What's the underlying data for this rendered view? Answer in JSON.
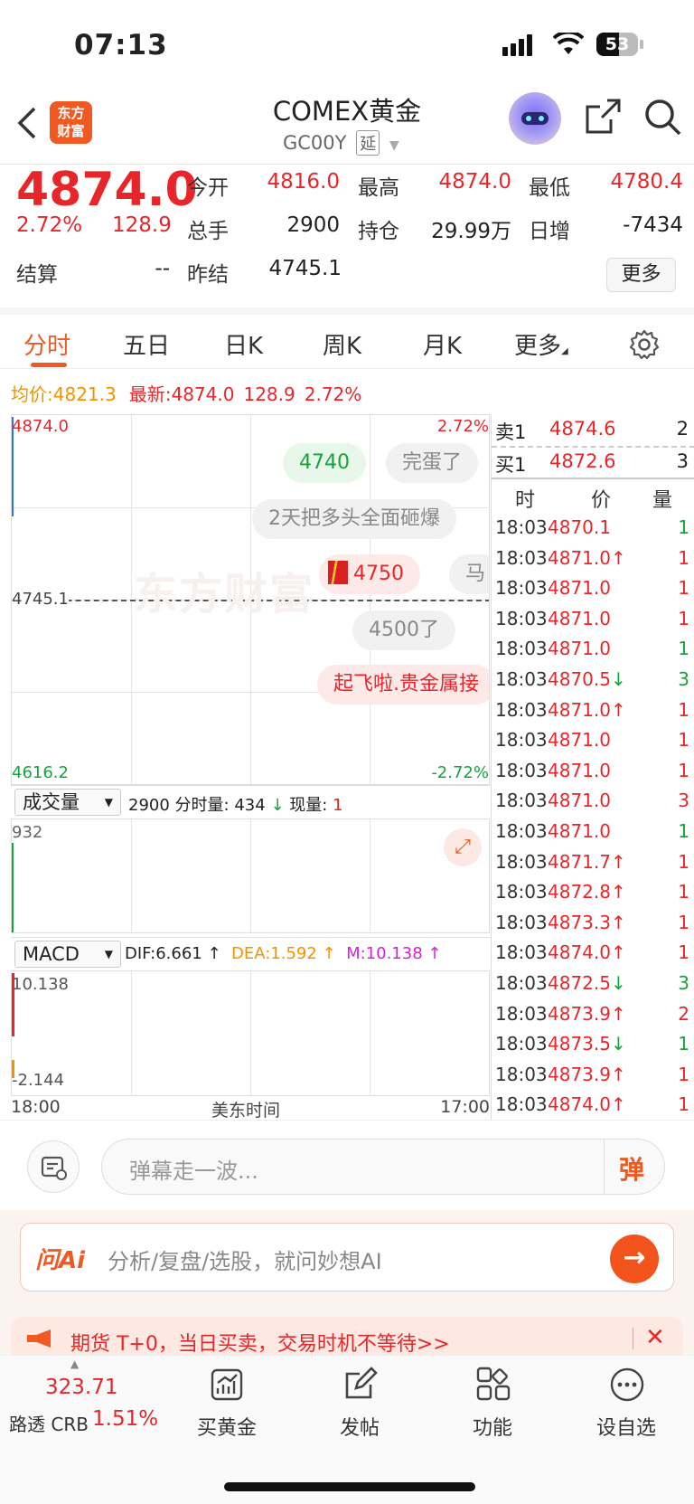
{
  "status_bar": {
    "time": "07:13",
    "battery": "53"
  },
  "header": {
    "logo_text_1": "东方",
    "logo_text_2": "财富",
    "title": "COMEX黄金",
    "code": "GC00Y",
    "delay_badge": "延"
  },
  "quote": {
    "price": "4874.0",
    "change_pct": "2.72%",
    "change": "128.9",
    "open_label": "今开",
    "open": "4816.0",
    "high_label": "最高",
    "high": "4874.0",
    "low_label": "最低",
    "low": "4780.4",
    "volume_label": "总手",
    "volume": "2900",
    "position_label": "持仓",
    "position": "29.99万",
    "daily_inc_label": "日增",
    "daily_inc": "-7434",
    "settle_label": "结算",
    "settle": "--",
    "prev_settle_label": "昨结",
    "prev_settle": "4745.1",
    "more_btn": "更多"
  },
  "tabs": [
    "分时",
    "五日",
    "日K",
    "周K",
    "月K",
    "更多"
  ],
  "avg_line": {
    "avg_label": "均价:",
    "avg": "4821.3",
    "last_label": "最新:",
    "last": "4874.0",
    "chg": "128.9",
    "pct": "2.72%"
  },
  "price_chart": {
    "top": "4874.0",
    "top_pct": "2.72%",
    "mid": "4745.1",
    "bottom": "4616.2",
    "bottom_pct": "-2.72%",
    "watermark": "东方财富"
  },
  "danmaku": [
    "4740",
    "完蛋了",
    "2天把多头全面砸爆",
    "4750",
    "马",
    "4500了",
    "起飞啦.贵金属接"
  ],
  "volume_chart": {
    "selector": "成交量",
    "vol": "2900",
    "fen_label": "分时量:",
    "fen": "434",
    "cur_label": "现量:",
    "cur": "1",
    "max": "932"
  },
  "macd_chart": {
    "selector": "MACD",
    "dif": "DIF:6.661",
    "dea": "DEA:1.592",
    "m": "M:10.138",
    "max": "10.138",
    "min": "-2.144"
  },
  "time_axis": {
    "start": "18:00",
    "mid": "美东时间",
    "end": "17:00"
  },
  "orderbook": {
    "sell_label": "卖1",
    "sell_price": "4874.6",
    "sell_qty": "2",
    "buy_label": "买1",
    "buy_price": "4872.6",
    "buy_qty": "3"
  },
  "trade_headers": {
    "time": "时",
    "price": "价",
    "qty": "量"
  },
  "trades": [
    {
      "t": "18:03",
      "p": "4870.1",
      "a": "",
      "v": "1",
      "pc": "red",
      "vc": "green"
    },
    {
      "t": "18:03",
      "p": "4871.0",
      "a": "↑",
      "v": "1",
      "pc": "red",
      "vc": "red"
    },
    {
      "t": "18:03",
      "p": "4871.0",
      "a": "",
      "v": "1",
      "pc": "red",
      "vc": "red"
    },
    {
      "t": "18:03",
      "p": "4871.0",
      "a": "",
      "v": "1",
      "pc": "red",
      "vc": "red"
    },
    {
      "t": "18:03",
      "p": "4871.0",
      "a": "",
      "v": "1",
      "pc": "red",
      "vc": "green"
    },
    {
      "t": "18:03",
      "p": "4870.5",
      "a": "↓",
      "v": "3",
      "pc": "red",
      "vc": "green"
    },
    {
      "t": "18:03",
      "p": "4871.0",
      "a": "↑",
      "v": "1",
      "pc": "red",
      "vc": "red"
    },
    {
      "t": "18:03",
      "p": "4871.0",
      "a": "",
      "v": "1",
      "pc": "red",
      "vc": "red"
    },
    {
      "t": "18:03",
      "p": "4871.0",
      "a": "",
      "v": "1",
      "pc": "red",
      "vc": "red"
    },
    {
      "t": "18:03",
      "p": "4871.0",
      "a": "",
      "v": "3",
      "pc": "red",
      "vc": "red"
    },
    {
      "t": "18:03",
      "p": "4871.0",
      "a": "",
      "v": "1",
      "pc": "red",
      "vc": "green"
    },
    {
      "t": "18:03",
      "p": "4871.7",
      "a": "↑",
      "v": "1",
      "pc": "red",
      "vc": "red"
    },
    {
      "t": "18:03",
      "p": "4872.8",
      "a": "↑",
      "v": "1",
      "pc": "red",
      "vc": "red"
    },
    {
      "t": "18:03",
      "p": "4873.3",
      "a": "↑",
      "v": "1",
      "pc": "red",
      "vc": "red"
    },
    {
      "t": "18:03",
      "p": "4874.0",
      "a": "↑",
      "v": "1",
      "pc": "red",
      "vc": "red"
    },
    {
      "t": "18:03",
      "p": "4872.5",
      "a": "↓",
      "v": "3",
      "pc": "red",
      "vc": "green"
    },
    {
      "t": "18:03",
      "p": "4873.9",
      "a": "↑",
      "v": "2",
      "pc": "red",
      "vc": "red"
    },
    {
      "t": "18:03",
      "p": "4873.5",
      "a": "↓",
      "v": "1",
      "pc": "red",
      "vc": "green"
    },
    {
      "t": "18:03",
      "p": "4873.9",
      "a": "↑",
      "v": "1",
      "pc": "red",
      "vc": "red"
    },
    {
      "t": "18:03",
      "p": "4874.0",
      "a": "↑",
      "v": "1",
      "pc": "red",
      "vc": "red"
    }
  ],
  "danmu_input": {
    "placeholder": "弹幕走一波...",
    "send": "弹"
  },
  "ai": {
    "brand": "问Ai",
    "placeholder": "分析/复盘/选股，就问妙想AI"
  },
  "banner": {
    "text": "期货 T+0，当日买卖，交易时机不等待>>"
  },
  "bottom_nav": {
    "index_value": "323.71",
    "index_name": "路透 CRB",
    "index_pct": "1.51%",
    "buy_gold": "买黄金",
    "post": "发帖",
    "func": "功能",
    "add_fav": "设自选"
  }
}
